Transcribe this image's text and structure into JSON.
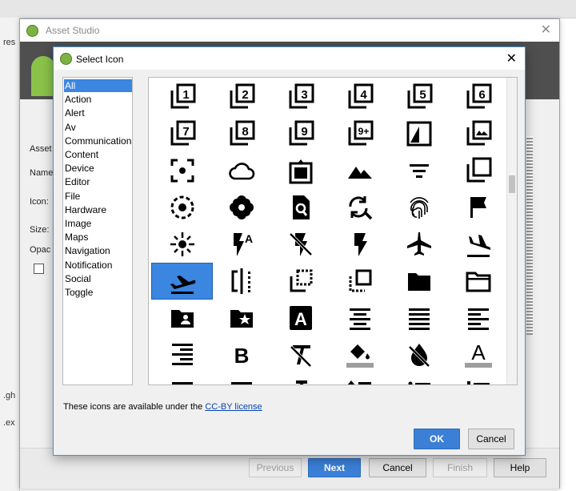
{
  "asset_window": {
    "title": "Asset Studio",
    "labels": [
      "Asset",
      "Name",
      "Icon:",
      "Size:",
      "Opac"
    ],
    "buttons": {
      "previous": "Previous",
      "next": "Next",
      "cancel": "Cancel",
      "finish": "Finish",
      "help": "Help"
    }
  },
  "ide_fragments": [
    "res",
    ".gh",
    ".ex"
  ],
  "dialog": {
    "title": "Select Icon",
    "categories": [
      "All",
      "Action",
      "Alert",
      "Av",
      "Communication",
      "Content",
      "Device",
      "Editor",
      "File",
      "Hardware",
      "Image",
      "Maps",
      "Navigation",
      "Notification",
      "Social",
      "Toggle"
    ],
    "selected_category": "All",
    "license_text": "These icons are available under the ",
    "license_link": "CC-BY license",
    "ok": "OK",
    "cancel": "Cancel"
  },
  "icons": [
    "filter-1-icon",
    "filter-2-icon",
    "filter-3-icon",
    "filter-4-icon",
    "filter-5-icon",
    "filter-6-icon",
    "filter-7-icon",
    "filter-8-icon",
    "filter-9-icon",
    "filter-9-plus-icon",
    "filter-bw-icon",
    "filter-photo-icon",
    "center-focus-icon",
    "cloud-icon",
    "frame-icon",
    "terrain-icon",
    "filter-list-icon",
    "library-icon",
    "focus-dashed-icon",
    "flower-icon",
    "find-in-page-icon",
    "find-replace-icon",
    "fingerprint-icon",
    "flag-icon",
    "flare-icon",
    "flash-auto-icon",
    "flash-off-icon",
    "flash-on-icon",
    "flight-icon",
    "flight-land-icon",
    "flight-takeoff-icon",
    "flip-icon",
    "flip-to-back-icon",
    "flip-to-front-icon",
    "folder-icon",
    "folder-open-icon",
    "folder-shared-icon",
    "folder-special-icon",
    "font-download-icon",
    "format-align-center-icon",
    "format-align-justify-icon",
    "format-align-left-icon",
    "format-align-right-icon",
    "format-bold-icon",
    "format-clear-icon",
    "format-color-fill-icon",
    "format-color-reset-icon",
    "format-color-text-icon",
    "format-indent-decrease-icon",
    "format-indent-increase-icon",
    "format-italic-icon",
    "format-line-spacing-icon",
    "format-list-bulleted-icon",
    "format-list-numbered-icon"
  ],
  "selected_icon": "flight-takeoff-icon",
  "icon_text": {
    "A": "A",
    "B": "B",
    "nine_plus": "9+"
  }
}
